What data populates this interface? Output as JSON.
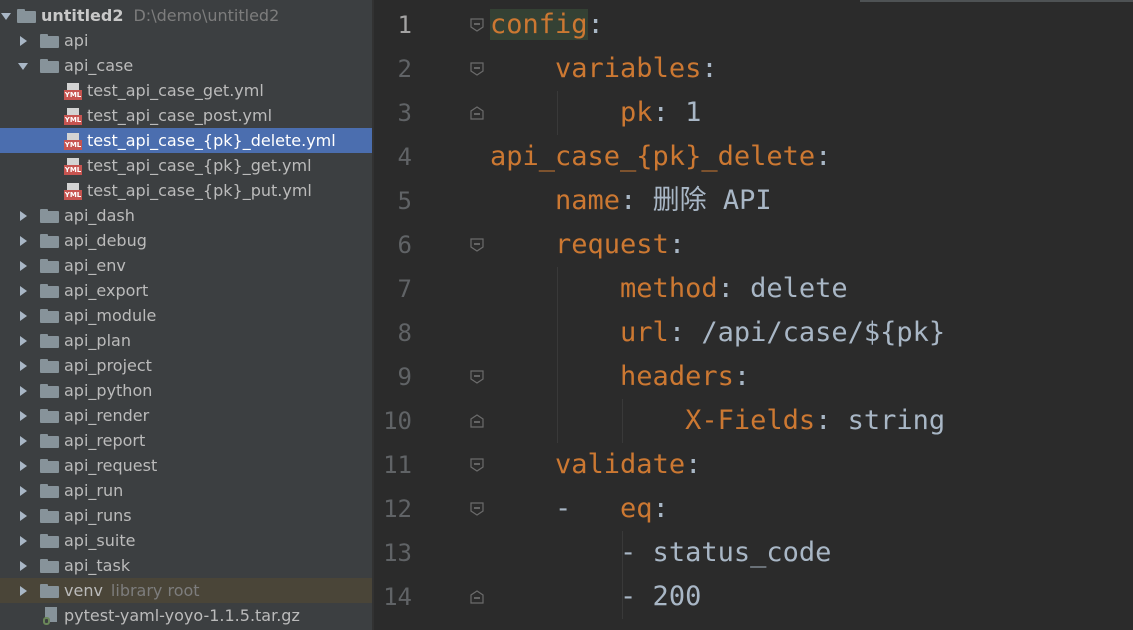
{
  "project_tree": {
    "root": {
      "name": "untitled2",
      "path": "D:\\demo\\untitled2"
    },
    "items": [
      {
        "label": "api",
        "type": "folder",
        "state": "collapsed",
        "depth": 1
      },
      {
        "label": "api_case",
        "type": "folder",
        "state": "expanded",
        "depth": 1
      },
      {
        "label": "test_api_case_get.yml",
        "type": "yml",
        "depth": 2
      },
      {
        "label": "test_api_case_post.yml",
        "type": "yml",
        "depth": 2
      },
      {
        "label": "test_api_case_{pk}_delete.yml",
        "type": "yml",
        "depth": 2,
        "selected": true
      },
      {
        "label": "test_api_case_{pk}_get.yml",
        "type": "yml",
        "depth": 2
      },
      {
        "label": "test_api_case_{pk}_put.yml",
        "type": "yml",
        "depth": 2
      },
      {
        "label": "api_dash",
        "type": "folder",
        "state": "collapsed",
        "depth": 1
      },
      {
        "label": "api_debug",
        "type": "folder",
        "state": "collapsed",
        "depth": 1
      },
      {
        "label": "api_env",
        "type": "folder",
        "state": "collapsed",
        "depth": 1
      },
      {
        "label": "api_export",
        "type": "folder",
        "state": "collapsed",
        "depth": 1
      },
      {
        "label": "api_module",
        "type": "folder",
        "state": "collapsed",
        "depth": 1
      },
      {
        "label": "api_plan",
        "type": "folder",
        "state": "collapsed",
        "depth": 1
      },
      {
        "label": "api_project",
        "type": "folder",
        "state": "collapsed",
        "depth": 1
      },
      {
        "label": "api_python",
        "type": "folder",
        "state": "collapsed",
        "depth": 1
      },
      {
        "label": "api_render",
        "type": "folder",
        "state": "collapsed",
        "depth": 1
      },
      {
        "label": "api_report",
        "type": "folder",
        "state": "collapsed",
        "depth": 1
      },
      {
        "label": "api_request",
        "type": "folder",
        "state": "collapsed",
        "depth": 1
      },
      {
        "label": "api_run",
        "type": "folder",
        "state": "collapsed",
        "depth": 1
      },
      {
        "label": "api_runs",
        "type": "folder",
        "state": "collapsed",
        "depth": 1
      },
      {
        "label": "api_suite",
        "type": "folder",
        "state": "collapsed",
        "depth": 1
      },
      {
        "label": "api_task",
        "type": "folder",
        "state": "collapsed",
        "depth": 1
      },
      {
        "label": "venv",
        "hint": "library root",
        "type": "folder",
        "state": "collapsed",
        "depth": 1,
        "highlight": true
      },
      {
        "label": "pytest-yaml-yoyo-1.1.5.tar.gz",
        "type": "archive",
        "depth": 1
      }
    ]
  },
  "editor": {
    "current_line": 1,
    "lines": [
      {
        "n": "1",
        "key": "config",
        "sep": ":",
        "val": "",
        "indent": "",
        "fold": "open",
        "key_highlight": true
      },
      {
        "n": "2",
        "key": "variables",
        "sep": ":",
        "val": "",
        "indent": "    ",
        "fold": "open"
      },
      {
        "n": "3",
        "key": "pk",
        "sep": ":",
        "val": " 1",
        "indent": "        ",
        "fold": "end"
      },
      {
        "n": "4",
        "key": "api_case_{pk}_delete",
        "sep": ":",
        "val": "",
        "indent": "",
        "fold": "none"
      },
      {
        "n": "5",
        "key": "name",
        "sep": ":",
        "val": " 删除 API",
        "indent": "    ",
        "fold": "none"
      },
      {
        "n": "6",
        "key": "request",
        "sep": ":",
        "val": "",
        "indent": "    ",
        "fold": "open"
      },
      {
        "n": "7",
        "key": "method",
        "sep": ":",
        "val": " delete",
        "indent": "        ",
        "fold": "none"
      },
      {
        "n": "8",
        "key": "url",
        "sep": ":",
        "val": " /api/case/${pk}",
        "indent": "        ",
        "fold": "none"
      },
      {
        "n": "9",
        "key": "headers",
        "sep": ":",
        "val": "",
        "indent": "        ",
        "fold": "open"
      },
      {
        "n": "10",
        "key": "X-Fields",
        "sep": ":",
        "val": " string",
        "indent": "            ",
        "fold": "end"
      },
      {
        "n": "11",
        "key": "validate",
        "sep": ":",
        "val": "",
        "indent": "    ",
        "fold": "open"
      },
      {
        "n": "12",
        "key": "eq",
        "sep": ":",
        "val": "",
        "indent": "    -   ",
        "fold": "open"
      },
      {
        "n": "13",
        "key": "",
        "sep": "",
        "val": "- status_code",
        "indent": "        ",
        "fold": "none"
      },
      {
        "n": "14",
        "key": "",
        "sep": "",
        "val": "- 200",
        "indent": "        ",
        "fold": "end"
      }
    ]
  },
  "colors": {
    "tree_bg": "#3c3f41",
    "editor_bg": "#2b2b2b",
    "selection": "#4b6eaf",
    "yaml_key": "#cc7832",
    "text": "#a9b7c6"
  },
  "icons": {
    "folder": "folder-icon",
    "yml": "yml-file-icon",
    "archive": "archive-file-icon",
    "fold": "fold-marker-icon"
  }
}
